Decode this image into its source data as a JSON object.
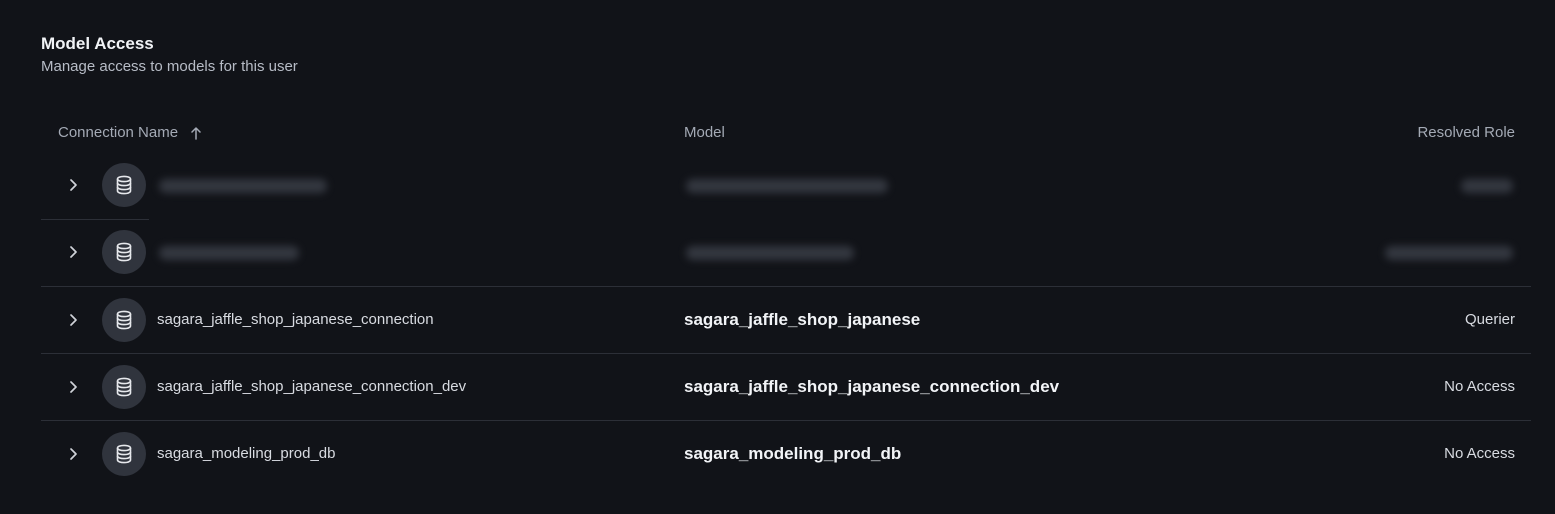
{
  "section": {
    "title": "Model Access",
    "subtitle": "Manage access to models for this user"
  },
  "table": {
    "columns": {
      "connection": "Connection Name",
      "model": "Model",
      "role": "Resolved Role"
    },
    "rows": [
      {
        "connection": "",
        "model": "",
        "role": "",
        "redacted": true
      },
      {
        "connection": "",
        "model": "",
        "role": "",
        "redacted": true
      },
      {
        "connection": "sagara_jaffle_shop_japanese_connection",
        "model": "sagara_jaffle_shop_japanese",
        "role": "Querier",
        "redacted": false
      },
      {
        "connection": "sagara_jaffle_shop_japanese_connection_dev",
        "model": "sagara_jaffle_shop_japanese_connection_dev",
        "role": "No Access",
        "redacted": false
      },
      {
        "connection": "sagara_modeling_prod_db",
        "model": "sagara_modeling_prod_db",
        "role": "No Access",
        "redacted": false
      }
    ]
  },
  "icons": {
    "sort": "arrow-up-icon",
    "expand": "chevron-right-icon",
    "connection": "database-icon"
  },
  "colors": {
    "background": "#111318",
    "badge": "#30343d",
    "divider": "#2c2f37"
  }
}
